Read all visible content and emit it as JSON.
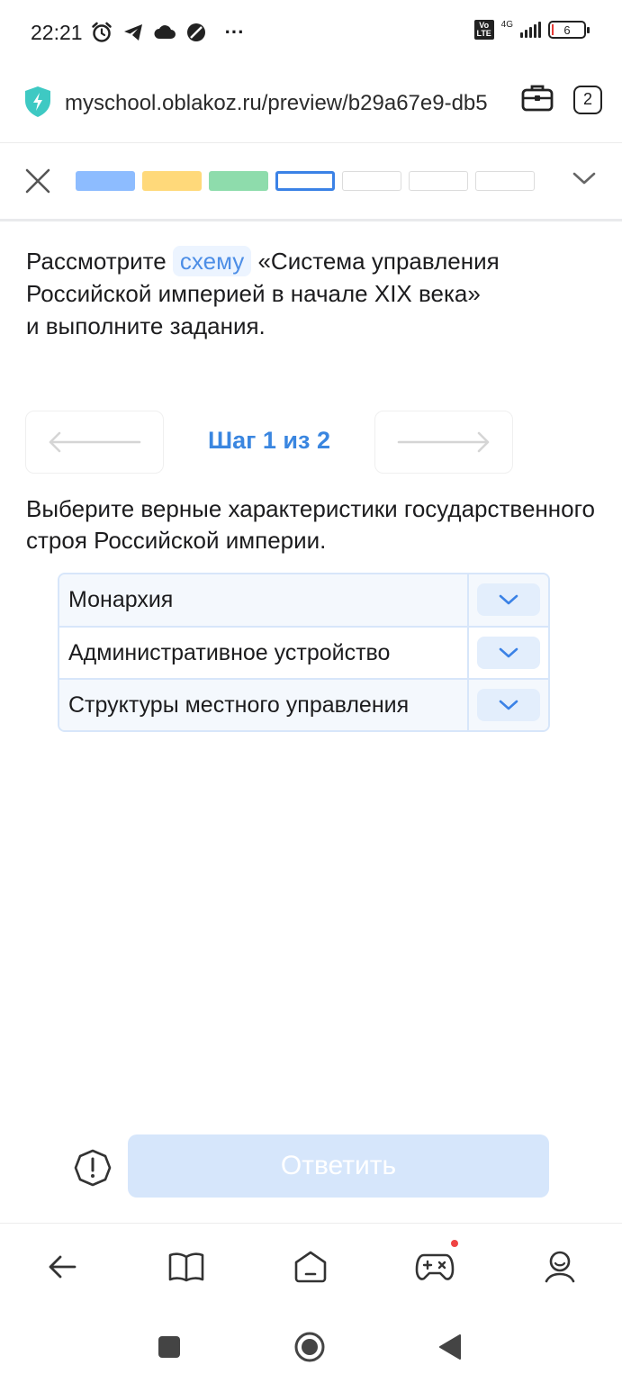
{
  "status_bar": {
    "time": "22:21",
    "more": "···",
    "volte": "Vo LTE",
    "network": "4G",
    "battery_level": "6"
  },
  "browser": {
    "url": "myschool.oblakoz.ru/preview/b29a67e9-db5",
    "tabs_count": "2"
  },
  "progress": {
    "steps": [
      "blue",
      "yellow",
      "green",
      "current",
      "empty",
      "empty",
      "empty"
    ]
  },
  "task": {
    "prefix": "Рассмотрите ",
    "link": "схему",
    "suffix_line1": " «Система управления",
    "line2": "Российской империей в начале XIX века»",
    "line3": "и выполните задания."
  },
  "step_nav": {
    "label": "Шаг 1 из 2"
  },
  "question": {
    "text": "Выберите верные характеристики государственного строя Российской империи."
  },
  "table": {
    "rows": [
      "Монархия",
      "Административное устройство",
      "Структуры местного управления"
    ]
  },
  "answer_bar": {
    "submit_label": "Ответить"
  },
  "colors": {
    "accent": "#3a86e0",
    "submit_disabled": "#d6e6fb",
    "table_border": "#d7e6fa"
  }
}
